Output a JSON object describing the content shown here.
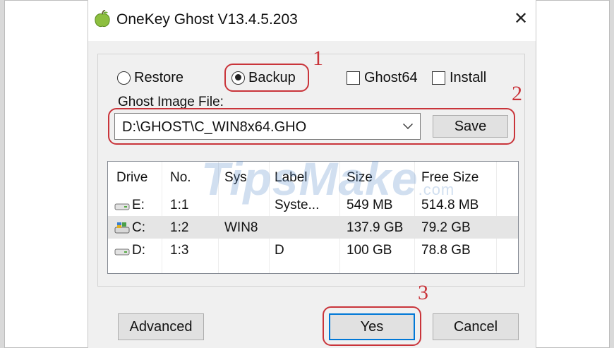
{
  "window": {
    "title": "OneKey Ghost V13.4.5.203",
    "close_icon": "✕"
  },
  "options": {
    "restore": {
      "label": "Restore",
      "checked": false
    },
    "backup": {
      "label": "Backup",
      "checked": true
    },
    "ghost64": {
      "label": "Ghost64",
      "checked": false
    },
    "install": {
      "label": "Install",
      "checked": false
    }
  },
  "image_file": {
    "label": "Ghost Image File:",
    "value": "D:\\GHOST\\C_WIN8x64.GHO",
    "save_label": "Save"
  },
  "table": {
    "columns": [
      "Drive",
      "No.",
      "Sys",
      "Label",
      "Size",
      "Free Size"
    ],
    "rows": [
      {
        "drive": "E:",
        "no": "1:1",
        "sys": "",
        "label": "Syste...",
        "size": "549 MB",
        "free": "514.8 MB",
        "icon": "hard-drive-icon",
        "selected": false
      },
      {
        "drive": "C:",
        "no": "1:2",
        "sys": "WIN8",
        "label": "",
        "size": "137.9 GB",
        "free": "79.2 GB",
        "icon": "system-drive-icon",
        "selected": true
      },
      {
        "drive": "D:",
        "no": "1:3",
        "sys": "",
        "label": "D",
        "size": "100 GB",
        "free": "78.8 GB",
        "icon": "hard-drive-icon",
        "selected": false
      }
    ]
  },
  "buttons": {
    "advanced": "Advanced",
    "yes": "Yes",
    "cancel": "Cancel"
  },
  "annotations": {
    "step1": "1",
    "step2": "2",
    "step3": "3"
  },
  "watermark": {
    "text": "TipsMake",
    "suffix": ".com"
  },
  "colors": {
    "highlight": "#c9343a",
    "selection": "#e5e5e5",
    "focus": "#0078d7"
  }
}
